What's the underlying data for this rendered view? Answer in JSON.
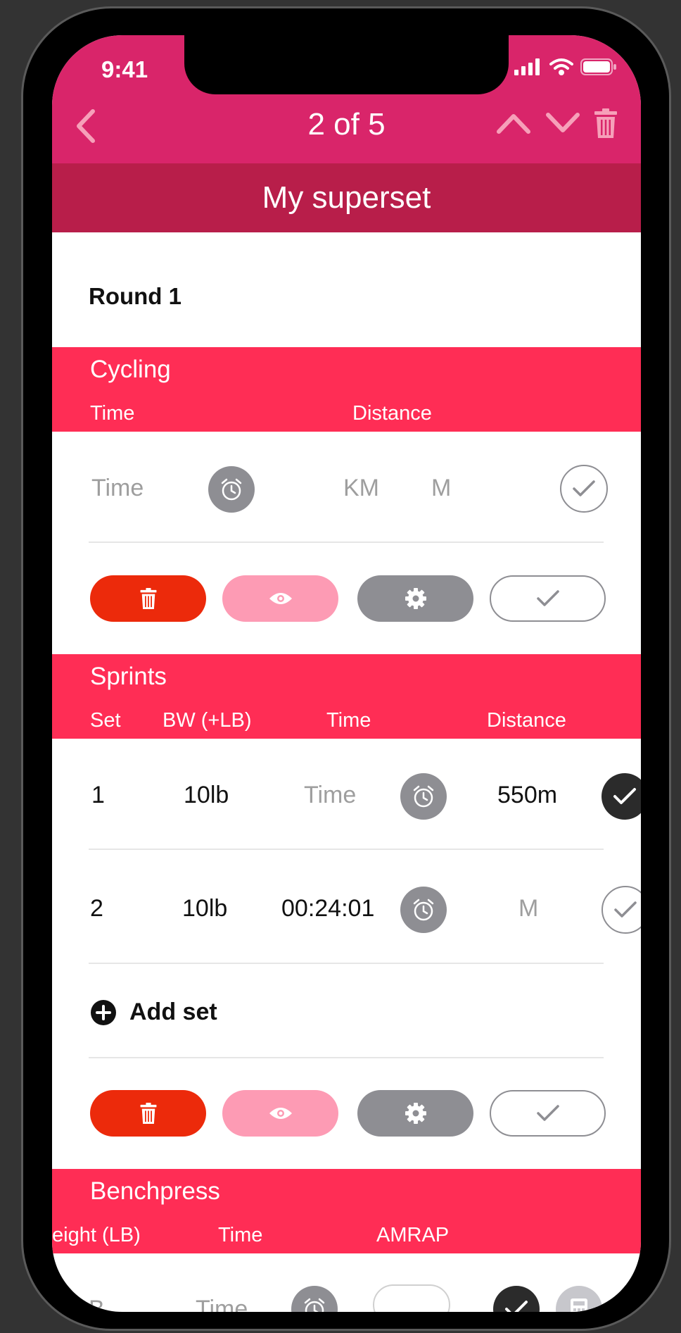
{
  "status_bar": {
    "time": "9:41"
  },
  "nav": {
    "title": "2 of 5"
  },
  "superset_title": "My superset",
  "round_label": "Round 1",
  "colors": {
    "topbar": "#d9256a",
    "superset_bar": "#b81e4a",
    "exercise_header": "#ff2d55",
    "delete": "#ec2a0b",
    "preview": "#fd9bb4",
    "settings": "#8e8e93"
  },
  "exercises": [
    {
      "name": "Cycling",
      "columns": [
        "Time",
        "Distance"
      ],
      "rows": [
        {
          "time": "Time",
          "unit_km": "KM",
          "unit_m": "M"
        }
      ]
    },
    {
      "name": "Sprints",
      "columns": [
        "Set",
        "BW (+LB)",
        "Time",
        "Distance"
      ],
      "rows": [
        {
          "set": "1",
          "bw": "10lb",
          "time": "Time",
          "distance": "550m",
          "done": true
        },
        {
          "set": "2",
          "bw": "10lb",
          "time": "00:24:01",
          "distance": "M",
          "done": false
        }
      ],
      "add_set_label": "Add set"
    },
    {
      "name": "Benchpress",
      "columns": [
        "eight (LB)",
        "Time",
        "AMRAP"
      ],
      "rows": [
        {
          "weight": "B",
          "time": "Time"
        }
      ]
    }
  ],
  "icons": [
    "chevron-left-icon",
    "chevron-up-icon",
    "chevron-down-icon",
    "trash-icon",
    "clock-icon",
    "check-icon",
    "eye-icon",
    "gear-icon",
    "plus-circle-icon",
    "calculator-icon"
  ]
}
